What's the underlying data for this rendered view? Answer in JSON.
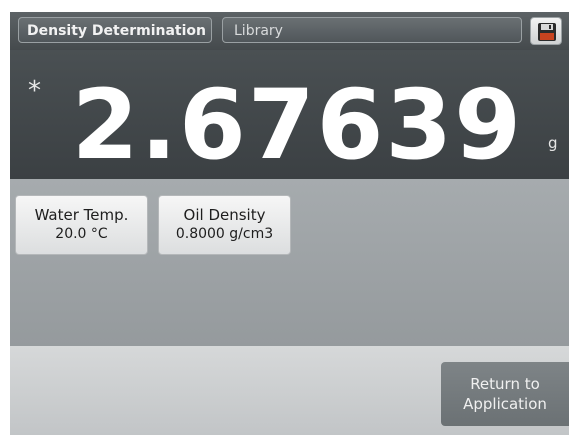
{
  "header": {
    "app_tab": "Density Determination",
    "library_tab": "Library",
    "save_icon": "floppy-disk-icon"
  },
  "display": {
    "stability_marker": "*",
    "reading": "2.67639",
    "unit": "g"
  },
  "params": [
    {
      "label": "Water Temp.",
      "value": "20.0 °C"
    },
    {
      "label": "Oil Density",
      "value": "0.8000 g/cm3"
    }
  ],
  "footer": {
    "return_line1": "Return to",
    "return_line2": "Application"
  },
  "colors": {
    "header_bg": "#4f5558",
    "display_bg": "#43484b",
    "params_bg": "#9ea3a6",
    "footer_bg": "#cdd0d1",
    "button_bg": "#ececec",
    "return_button_bg": "#75797c"
  }
}
